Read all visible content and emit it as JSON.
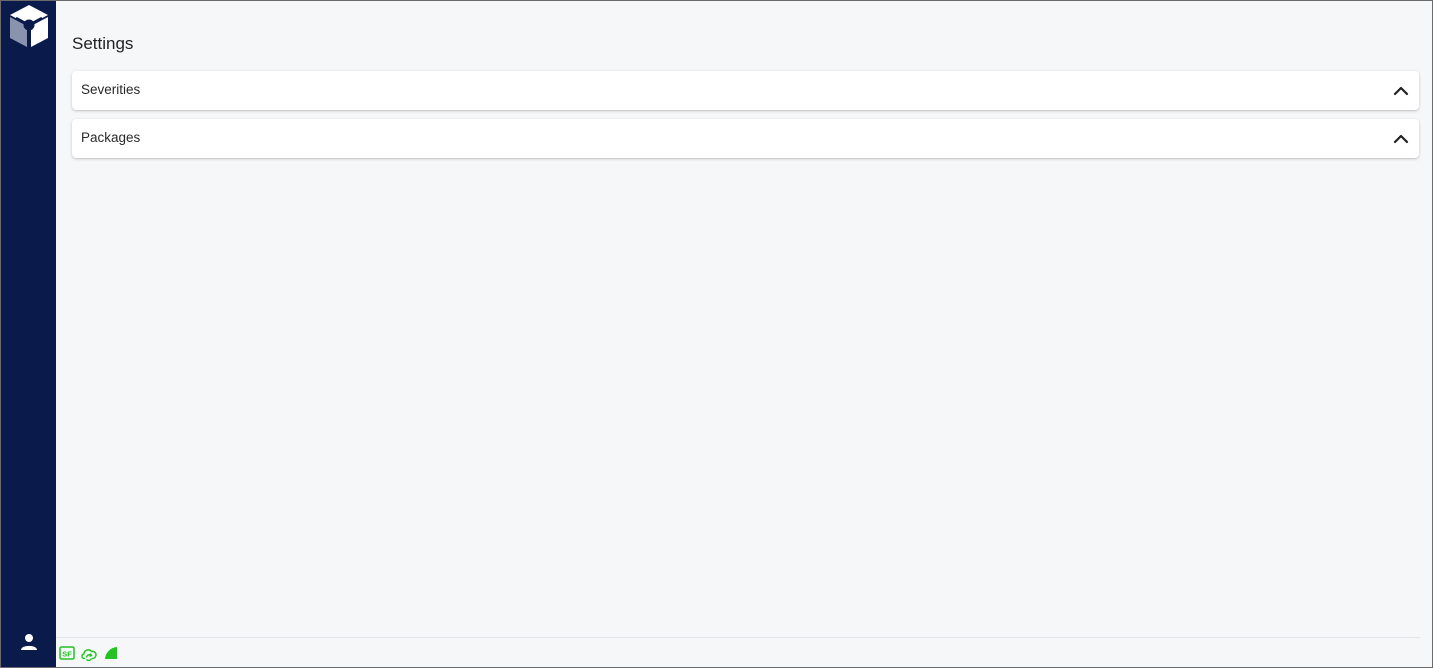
{
  "app": {
    "logo_icon": "cube-logo-icon"
  },
  "sidebar": {
    "user_icon": "user-icon"
  },
  "page": {
    "title": "Settings"
  },
  "panels": [
    {
      "label": "Severities",
      "expanded": true,
      "icon": "chevron-up-icon"
    },
    {
      "label": "Packages",
      "expanded": true,
      "icon": "chevron-up-icon"
    }
  ],
  "statusbar": {
    "items": [
      {
        "icon": "sf-badge-icon",
        "text": "SF",
        "color": "#22c322"
      },
      {
        "icon": "cloud-sync-icon",
        "color": "#22c322"
      },
      {
        "icon": "signal-icon",
        "color": "#22c322"
      }
    ]
  },
  "colors": {
    "sidebar_bg": "#0a1a4a",
    "page_bg": "#f6f7f9",
    "status_green": "#22c322"
  }
}
